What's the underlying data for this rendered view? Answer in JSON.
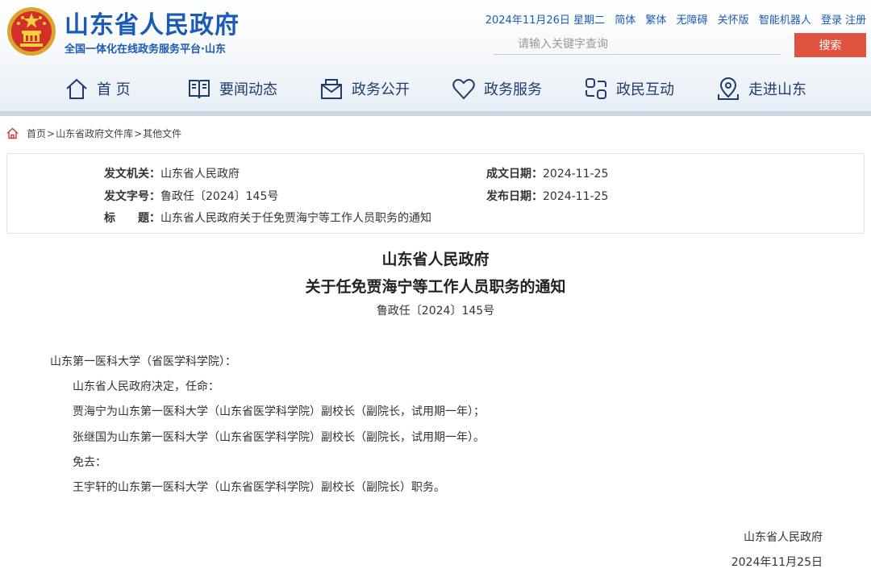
{
  "header": {
    "site_title": "山东省人民政府",
    "site_subtitle": "全国一体化在线政务服务平台·山东",
    "date_text": "2024年11月26日 星期二",
    "links": [
      "简体",
      "繁体",
      "无障碍",
      "关怀版",
      "智能机器人",
      "登录",
      "注册"
    ],
    "search_placeholder": "请输入关键字查询",
    "search_button": "搜索",
    "accent_color": "#1b5bb5",
    "button_color": "#e0533f"
  },
  "nav": [
    {
      "label": "首 页",
      "icon": "home-icon"
    },
    {
      "label": "要闻动态",
      "icon": "book-icon"
    },
    {
      "label": "政务公开",
      "icon": "mail-icon"
    },
    {
      "label": "政务服务",
      "icon": "heart-icon"
    },
    {
      "label": "政民互动",
      "icon": "interaction-icon"
    },
    {
      "label": "走进山东",
      "icon": "map-pin-icon"
    }
  ],
  "breadcrumb": [
    "首页",
    "山东省政府文件库",
    "其他文件"
  ],
  "info": {
    "issuer_label": "发文机关：",
    "issuer": "山东省人民政府",
    "docno_label": "发文字号：",
    "docno": "鲁政任〔2024〕145号",
    "title_label": "标　　题：",
    "title": "山东省人民政府关于任免贾海宁等工作人员职务的通知",
    "created_label": "成文日期：",
    "created": "2024-11-25",
    "published_label": "发布日期：",
    "published": "2024-11-25"
  },
  "document": {
    "title_line1": "山东省人民政府",
    "title_line2": "关于任免贾海宁等工作人员职务的通知",
    "number": "鲁政任〔2024〕145号",
    "addressee": "山东第一医科大学（省医学科学院）：",
    "paragraphs": [
      "山东省人民政府决定，任命：",
      "贾海宁为山东第一医科大学（山东省医学科学院）副校长（副院长，试用期一年）；",
      "张继国为山东第一医科大学（山东省医学科学院）副校长（副院长，试用期一年）。",
      "免去：",
      "王宇轩的山东第一医科大学（山东省医学科学院）副校长（副院长）职务。"
    ],
    "signature": "山东省人民政府",
    "date": "2024年11月25日"
  }
}
